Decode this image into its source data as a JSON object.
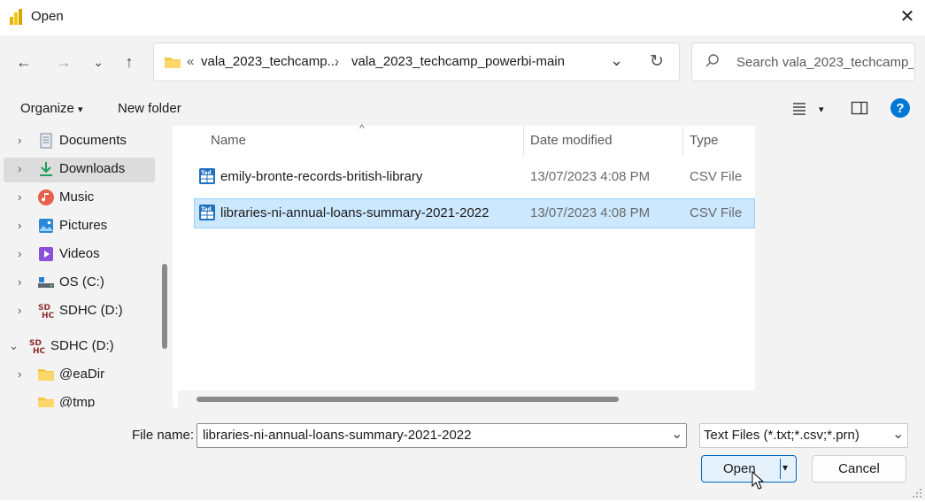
{
  "window": {
    "title": "Open",
    "close_glyph": "✕"
  },
  "nav": {
    "back_glyph": "←",
    "forward_glyph": "→",
    "recent_glyph": "⌄",
    "up_glyph": "↑",
    "refresh_glyph": "↻"
  },
  "address": {
    "overflow": "«",
    "crumbs": [
      "vala_2023_techcamp...",
      "vala_2023_techcamp_powerbi-main"
    ],
    "separator": "›",
    "dropdown_glyph": "⌄"
  },
  "search": {
    "placeholder": "Search vala_2023_techcamp_...",
    "icon": "search-icon"
  },
  "toolbar": {
    "organize_label": "Organize",
    "organize_caret": "▾",
    "new_folder_label": "New folder",
    "view_caret": "▾",
    "help_glyph": "?"
  },
  "sidebar": {
    "items": [
      {
        "label": "Documents",
        "icon": "documents-icon"
      },
      {
        "label": "Downloads",
        "icon": "downloads-icon"
      },
      {
        "label": "Music",
        "icon": "music-icon"
      },
      {
        "label": "Pictures",
        "icon": "pictures-icon"
      },
      {
        "label": "Videos",
        "icon": "videos-icon"
      },
      {
        "label": "OS (C:)",
        "icon": "drive-icon"
      },
      {
        "label": "SDHC (D:)",
        "icon": "sdcard-icon"
      },
      {
        "label": "SDHC (D:)",
        "icon": "sdcard-icon"
      },
      {
        "label": "@eaDir",
        "icon": "folder-icon"
      },
      {
        "label": "@tmp",
        "icon": "folder-icon"
      }
    ],
    "selected_index": 1
  },
  "filelist": {
    "columns": [
      "Name",
      "Date modified",
      "Type"
    ],
    "sort_glyph": "^",
    "rows": [
      {
        "name": "emily-bronte-records-british-library",
        "date": "13/07/2023 4:08 PM",
        "type": "CSV File"
      },
      {
        "name": "libraries-ni-annual-loans-summary-2021-2022",
        "date": "13/07/2023 4:08 PM",
        "type": "CSV File"
      }
    ],
    "selected_row": 1
  },
  "bottom": {
    "file_name_label": "File name:",
    "file_name_value": "libraries-ni-annual-loans-summary-2021-2022",
    "file_type_value": "Text Files (*.txt;*.csv;*.prn)",
    "open_label": "Open",
    "cancel_label": "Cancel",
    "split_caret": "▾",
    "select_caret": "⌄"
  },
  "colors": {
    "accent": "#0067c0",
    "selection": "#cce8ff",
    "chrome": "#f3f3f3",
    "help": "#0078d4"
  }
}
